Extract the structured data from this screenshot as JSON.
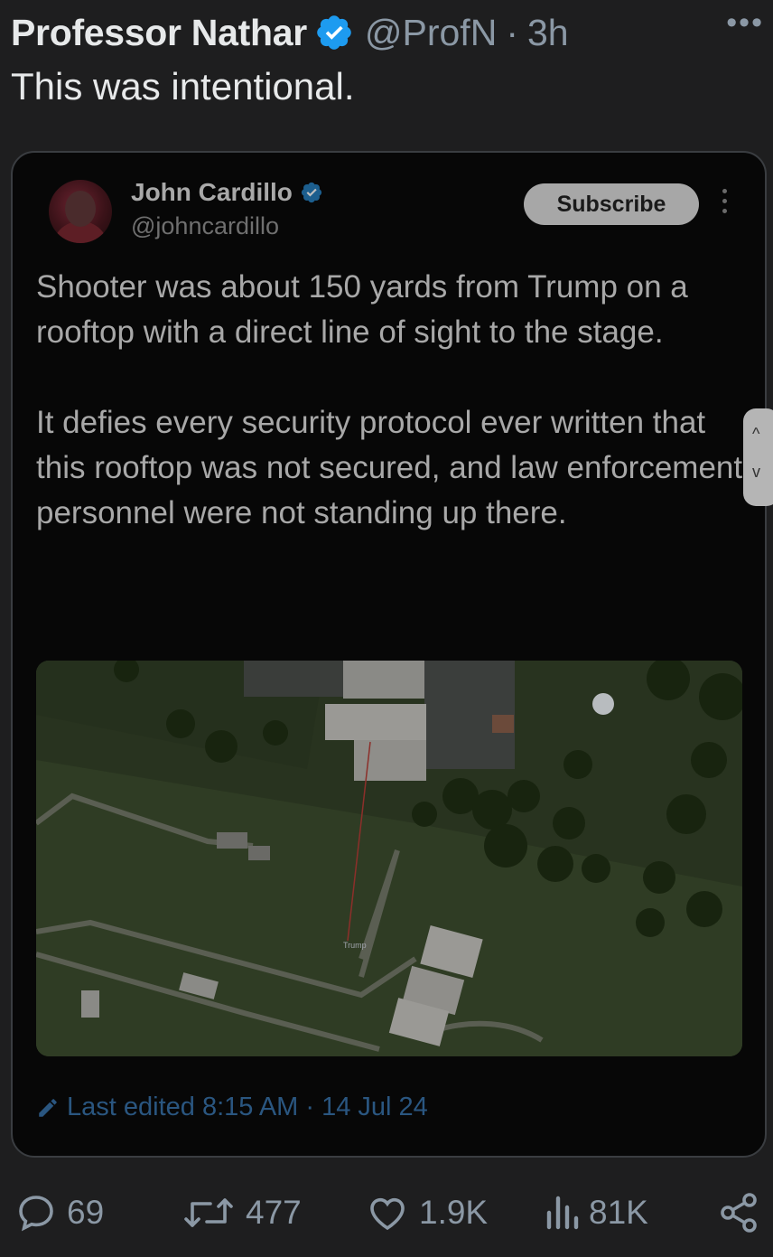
{
  "tweet": {
    "author_name": "Professor Nathar",
    "handle": "@ProfN",
    "separator": "·",
    "time": "3h",
    "more": "•••",
    "text": "This was intentional."
  },
  "quoted": {
    "author_name": "John Cardillo",
    "handle": "@johncardillo",
    "subscribe_label": "Subscribe",
    "paragraphs": [
      "Shooter was about 150 yards from Trump on a rooftop with a direct line of sight to the stage.",
      "It defies every security protocol ever written that this rooftop was not secured, and law enforcement personnel were not standing up there."
    ],
    "image_label": "Trump",
    "edited_text": "Last edited 8:15 AM · 14 Jul 24"
  },
  "scroll": {
    "up": "^",
    "down": "v"
  },
  "actions": {
    "replies": "69",
    "reposts": "477",
    "likes": "1.9K",
    "views": "81K"
  },
  "colors": {
    "background": "#1e1e1f",
    "verified": "#1d9bf0",
    "muted": "#8b98a5"
  }
}
